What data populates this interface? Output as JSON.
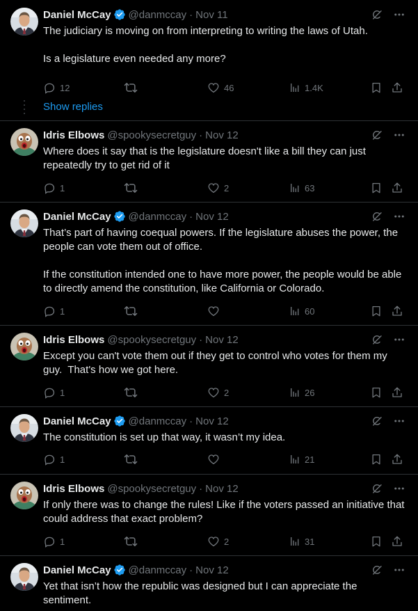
{
  "colors": {
    "background": "#000000",
    "text": "#e7e9ea",
    "muted": "#71767b",
    "link": "#1d9bf0",
    "verified": "#1d9bf0"
  },
  "show_replies_label": "Show replies",
  "tweets": [
    {
      "author": "Daniel McCay",
      "verified": true,
      "handle": "@danmccay",
      "sep": "·",
      "date": "Nov 11",
      "text": "The judiciary is moving on from interpreting to writing the laws of Utah.\n\nIs a legislature even needed any more?",
      "replies": "12",
      "retweets": "",
      "likes": "46",
      "views": "1.4K",
      "avatar": "man-avatar"
    },
    {
      "author": "Idris Elbows",
      "verified": false,
      "handle": "@spookysecretguy",
      "sep": "·",
      "date": "Nov 12",
      "text": "Where does it say that is the legislature doesn't like a bill they can just repeatedly try to get rid of it",
      "replies": "1",
      "retweets": "",
      "likes": "2",
      "views": "63",
      "avatar": "cartoon-avatar"
    },
    {
      "author": "Daniel McCay",
      "verified": true,
      "handle": "@danmccay",
      "sep": "·",
      "date": "Nov 12",
      "text": "That’s part of having coequal powers. If the legislature abuses the power, the people can vote them out of office.\n\nIf the constitution intended one to have more power, the people would be able to directly amend the constitution, like California or Colorado.",
      "replies": "1",
      "retweets": "",
      "likes": "",
      "views": "60",
      "avatar": "man-avatar"
    },
    {
      "author": "Idris Elbows",
      "verified": false,
      "handle": "@spookysecretguy",
      "sep": "·",
      "date": "Nov 12",
      "text": "Except you can't vote them out if they get to control who votes for them my guy.  That's how we got here.",
      "replies": "1",
      "retweets": "",
      "likes": "2",
      "views": "26",
      "avatar": "cartoon-avatar"
    },
    {
      "author": "Daniel McCay",
      "verified": true,
      "handle": "@danmccay",
      "sep": "·",
      "date": "Nov 12",
      "text": "The constitution is set up that way, it wasn’t my idea.",
      "replies": "1",
      "retweets": "",
      "likes": "",
      "views": "21",
      "avatar": "man-avatar"
    },
    {
      "author": "Idris Elbows",
      "verified": false,
      "handle": "@spookysecretguy",
      "sep": "·",
      "date": "Nov 12",
      "text": "If only there was to change the rules! Like if the voters passed an initiative that could address that exact problem?",
      "replies": "1",
      "retweets": "",
      "likes": "2",
      "views": "31",
      "avatar": "cartoon-avatar"
    },
    {
      "author": "Daniel McCay",
      "verified": true,
      "handle": "@danmccay",
      "sep": "·",
      "date": "Nov 12",
      "text": "Yet that isn’t how the republic was designed but I can appreciate the sentiment.",
      "replies": "",
      "retweets": "",
      "likes": "",
      "views": "",
      "avatar": "man-avatar"
    }
  ]
}
